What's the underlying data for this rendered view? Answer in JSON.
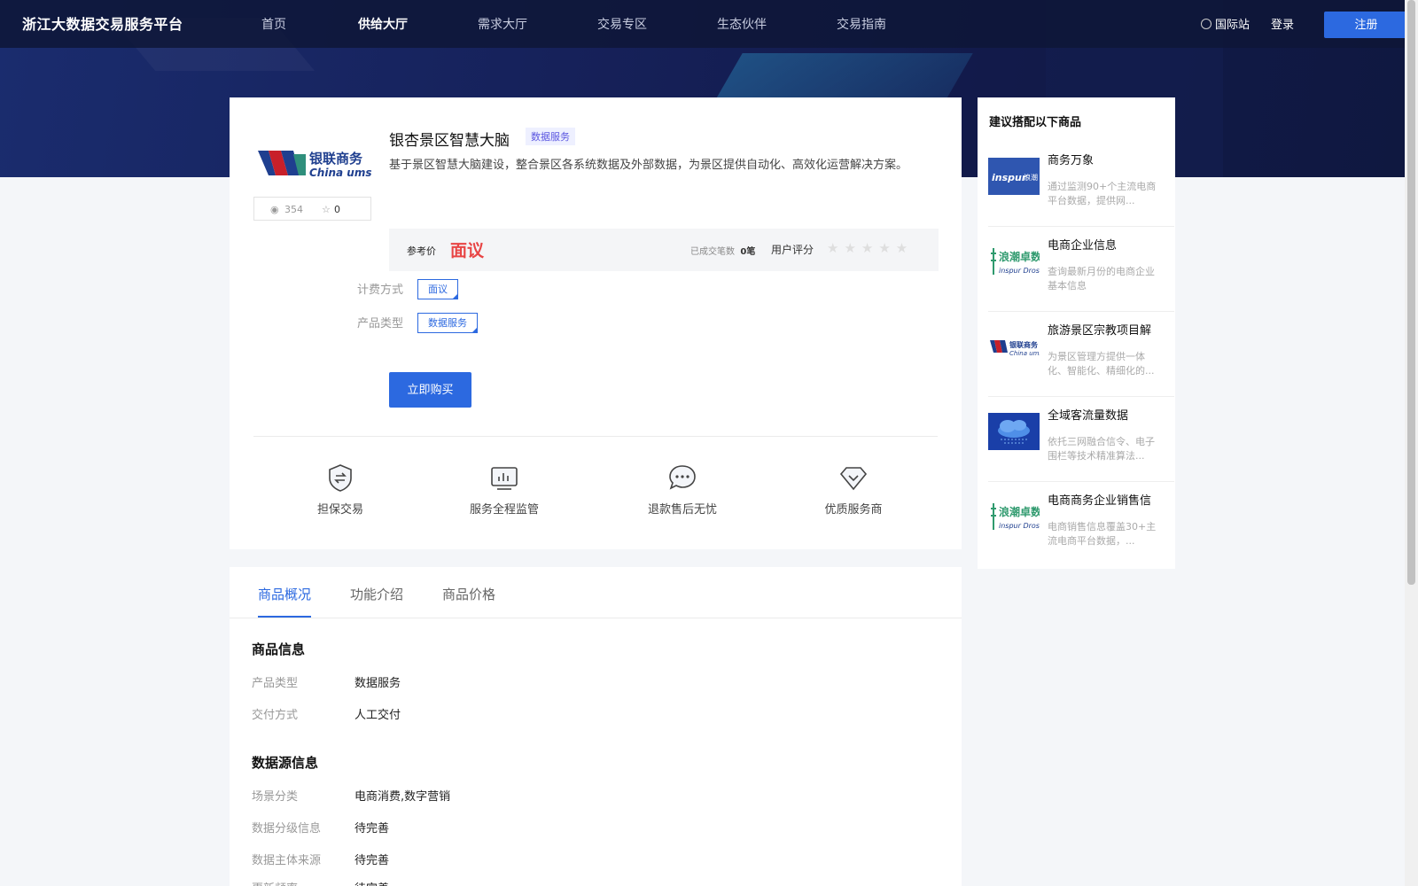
{
  "nav": {
    "logo": "浙江大数据交易服务平台",
    "items": [
      "首页",
      "供给大厅",
      "需求大厅",
      "交易专区",
      "生态伙伴",
      "交易指南"
    ],
    "intl": "国际站",
    "login": "登录",
    "register": "注册"
  },
  "product": {
    "logo_text": "银联商务",
    "logo_sub": "China ums",
    "views": "354",
    "favorites": "0",
    "title": "银杏景区智慧大脑",
    "tag": "数据服务",
    "description": "基于景区智慧大脑建设，整合景区各系统数据及外部数据，为景区提供自动化、高效化运营解决方案。",
    "price_label": "参考价",
    "price_value": "面议",
    "deals_label": "已成交笔数",
    "deals_value": "0笔",
    "rating_label": "用户评分",
    "rating": 0,
    "billing_label": "计费方式",
    "billing_value": "面议",
    "type_label": "产品类型",
    "type_value": "数据服务",
    "buy_label": "立即购买"
  },
  "features": [
    {
      "label": "担保交易",
      "icon": "shield-exchange-icon"
    },
    {
      "label": "服务全程监管",
      "icon": "monitor-chart-icon"
    },
    {
      "label": "退款售后无忧",
      "icon": "chat-bubble-icon"
    },
    {
      "label": "优质服务商",
      "icon": "diamond-check-icon"
    }
  ],
  "tabs": [
    "商品概况",
    "功能介绍",
    "商品价格"
  ],
  "info": {
    "section1": "商品信息",
    "rows1": [
      {
        "label": "产品类型",
        "value": "数据服务"
      },
      {
        "label": "交付方式",
        "value": "人工交付"
      }
    ],
    "section2": "数据源信息",
    "rows2": [
      {
        "label": "场景分类",
        "value": "电商消费,数字营销"
      },
      {
        "label": "数据分级信息",
        "value": "待完善"
      },
      {
        "label": "数据主体来源",
        "value": "待完善"
      },
      {
        "label": "更新频率",
        "value": "待完善"
      }
    ]
  },
  "side": {
    "title": "建议搭配以下商品",
    "items": [
      {
        "name": "商务万象",
        "desc": "通过监测90+个主流电商平台数据，提供网...",
        "img": "inspur-logo"
      },
      {
        "name": "电商企业信息",
        "desc": "查询最新月份的电商企业基本信息",
        "img": "inspur-droso-logo"
      },
      {
        "name": "旅游景区宗教项目解",
        "desc": "为景区管理方提供一体化、智能化、精细化的...",
        "img": "chinaums-logo"
      },
      {
        "name": "全域客流量数据",
        "desc": "依托三网融合信令、电子围栏等技术精准算法...",
        "img": "cloud-data-image"
      },
      {
        "name": "电商商务企业销售信",
        "desc": "电商销售信息覆盖30+主流电商平台数据，...",
        "img": "inspur-droso-logo"
      }
    ]
  },
  "colors": {
    "primary": "#2c69e0",
    "price": "#e84545",
    "nav_bg": "#0e1637"
  }
}
